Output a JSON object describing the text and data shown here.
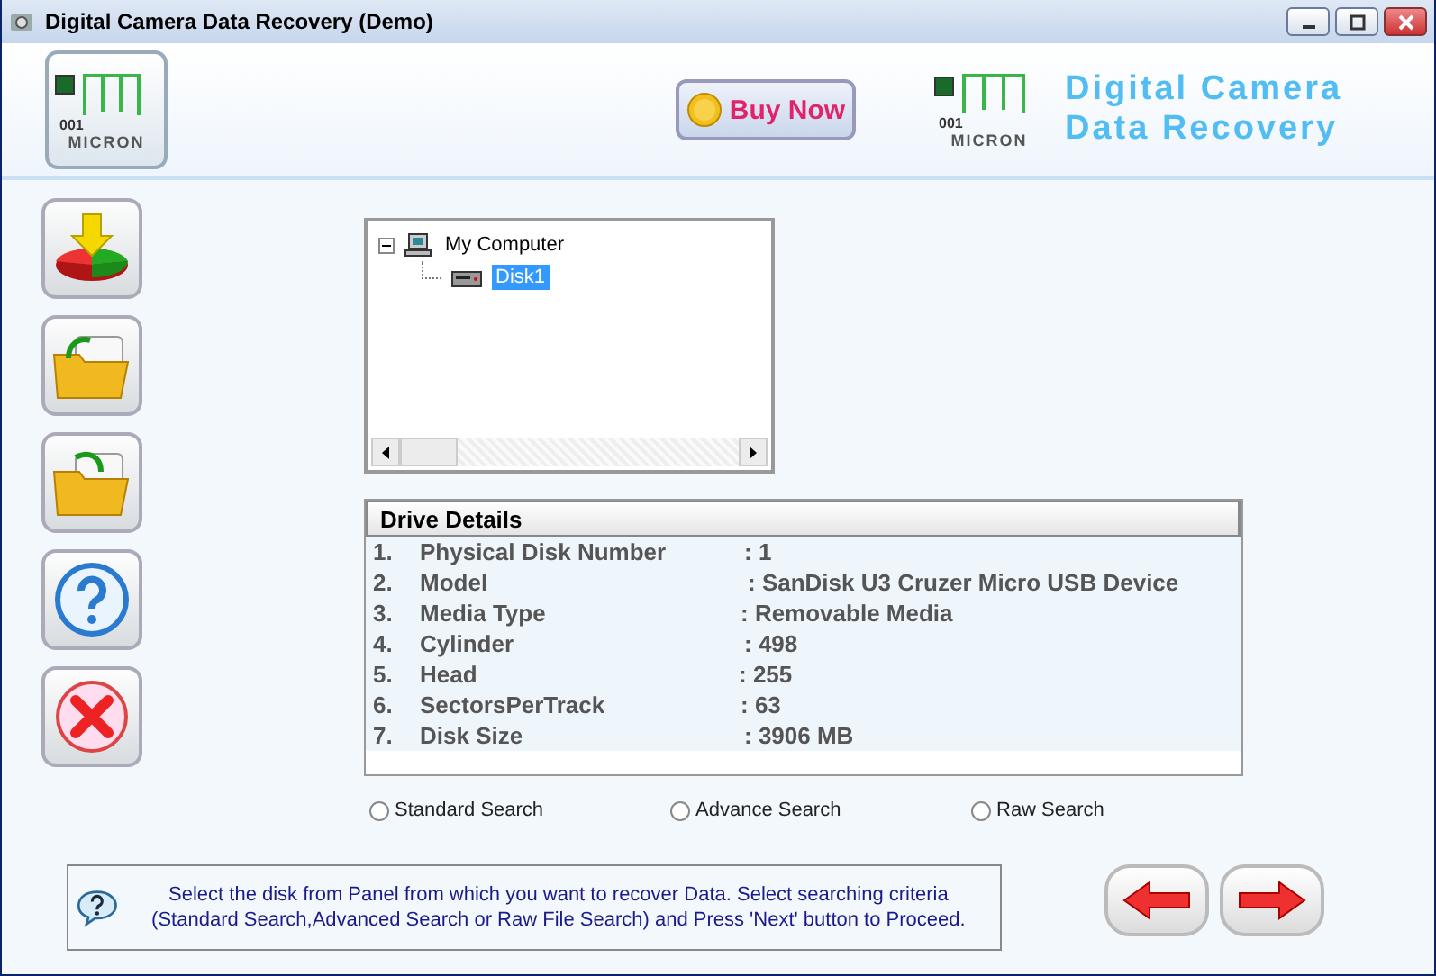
{
  "window": {
    "title": "Digital Camera Data Recovery (Demo)"
  },
  "header": {
    "logo": {
      "digits": "001",
      "name": "MICRON"
    },
    "buy_button": "Buy Now",
    "brand": {
      "digits": "001",
      "name": "MICRON",
      "line1": "Digital Camera",
      "line2": "Data Recovery"
    }
  },
  "sidebar": {
    "buttons": [
      {
        "kind": "recover"
      },
      {
        "kind": "open"
      },
      {
        "kind": "save"
      },
      {
        "kind": "help"
      },
      {
        "kind": "exit"
      }
    ]
  },
  "tree": {
    "items": [
      {
        "label": "My Computer",
        "expanded": true,
        "selected": false,
        "children": [
          {
            "label": "Disk1",
            "selected": true
          }
        ]
      }
    ]
  },
  "drive_details": {
    "title": "Drive Details",
    "rows": [
      {
        "index": "1.",
        "label": "Physical Disk Number",
        "value": ": 1"
      },
      {
        "index": "2.",
        "label": "Model",
        "value": ": SanDisk U3 Cruzer Micro USB Device"
      },
      {
        "index": "3.",
        "label": "Media Type",
        "value": ": Removable Media"
      },
      {
        "index": "4.",
        "label": "Cylinder",
        "value": ": 498"
      },
      {
        "index": "5.",
        "label": "Head",
        "value": ": 255"
      },
      {
        "index": "6.",
        "label": "SectorsPerTrack",
        "value": ": 63"
      },
      {
        "index": "7.",
        "label": "Disk Size",
        "value": ": 3906 MB"
      }
    ]
  },
  "search_options": [
    {
      "label": "Standard Search",
      "selected": false
    },
    {
      "label": "Advance Search",
      "selected": false
    },
    {
      "label": "Raw Search",
      "selected": false
    }
  ],
  "info": "Select the disk from Panel from which you want to recover Data. Select searching criteria (Standard Search,Advanced Search or Raw File Search) and Press 'Next' button to Proceed.",
  "nav": [
    {
      "kind": "back"
    },
    {
      "kind": "next"
    }
  ]
}
